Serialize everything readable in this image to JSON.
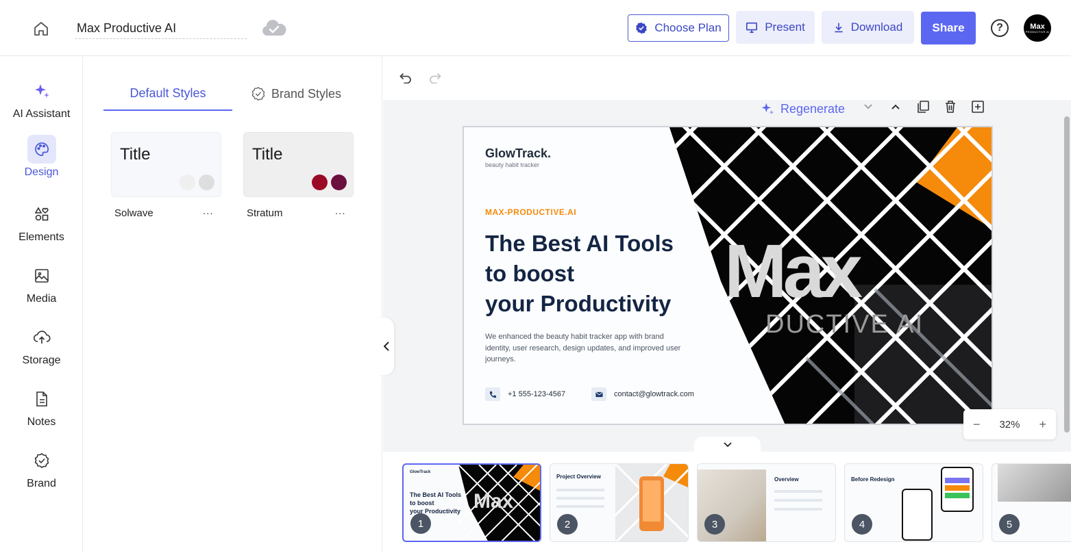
{
  "header": {
    "doc_title": "Max Productive AI",
    "choose_plan": "Choose Plan",
    "present": "Present",
    "download": "Download",
    "share": "Share",
    "help": "?",
    "avatar_line1": "Max",
    "avatar_line2": "PRODUCTIVE AI"
  },
  "rail": {
    "items": [
      {
        "label": "AI Assistant",
        "icon": "sparkle-icon"
      },
      {
        "label": "Design",
        "icon": "palette-icon"
      },
      {
        "label": "Elements",
        "icon": "shapes-icon"
      },
      {
        "label": "Media",
        "icon": "image-icon"
      },
      {
        "label": "Storage",
        "icon": "cloud-upload-icon"
      },
      {
        "label": "Notes",
        "icon": "document-icon"
      },
      {
        "label": "Brand",
        "icon": "badge-check-icon"
      }
    ]
  },
  "panel": {
    "tab_default": "Default Styles",
    "tab_brand": "Brand Styles",
    "styles": [
      {
        "card_title": "Title",
        "name": "Solwave",
        "more": "...",
        "dot_colors": [
          "#efefef",
          "#dedede"
        ]
      },
      {
        "card_title": "Title",
        "name": "Stratum",
        "more": "...",
        "dot_colors": [
          "#9b0a25",
          "#6b0f3f"
        ]
      }
    ]
  },
  "canvas": {
    "regenerate": "Regenerate",
    "zoom_level": "32%",
    "zoom_minus": "−",
    "zoom_plus": "+"
  },
  "slide": {
    "logo": "GlowTrack.",
    "logo_sub": "beauty habit tracker",
    "kicker": "MAX-PRODUCTIVE.AI",
    "head_line1": "The Best AI Tools",
    "head_line2": "to boost",
    "head_line3": "your Productivity",
    "body": "We enhanced the beauty habit tracker app with brand identity, user research, design updates, and improved user journeys.",
    "phone": "+1 555-123-4567",
    "email": "contact@glowtrack.com",
    "art_big": "Max",
    "art_sub": "DUCTIVE AI"
  },
  "thumbnails": [
    {
      "num": "1",
      "active": true,
      "line1": "The Best AI Tools",
      "line2": "to boost",
      "line3": "your Productivity",
      "logo": "GlowTrack"
    },
    {
      "num": "2",
      "active": false,
      "title": "Project Overview"
    },
    {
      "num": "3",
      "active": false,
      "title": "Overview"
    },
    {
      "num": "4",
      "active": false,
      "title": "Before Redesign"
    },
    {
      "num": "5",
      "active": false
    }
  ],
  "colors": {
    "accent": "#5b67f1",
    "orange": "#f58a0b",
    "navy": "#142544"
  }
}
